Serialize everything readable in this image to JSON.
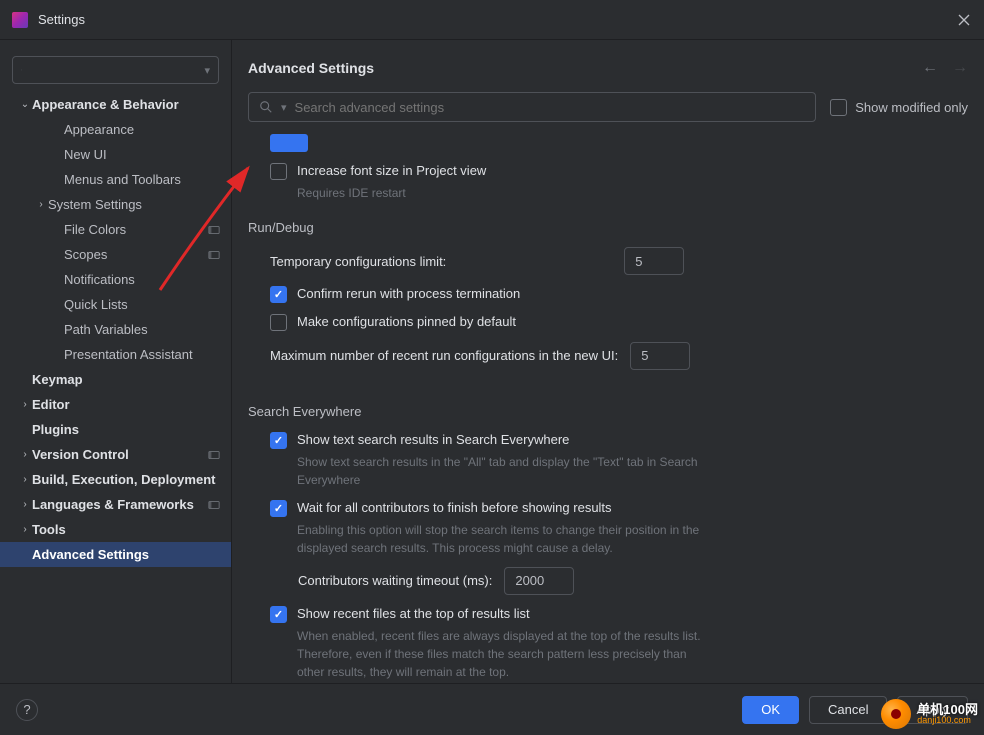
{
  "titlebar": {
    "title": "Settings"
  },
  "sidebar": {
    "search_placeholder": "",
    "items": [
      {
        "label": "Appearance & Behavior",
        "bold": true,
        "arrow": "down",
        "lvl": 0,
        "proj": false
      },
      {
        "label": "Appearance",
        "bold": false,
        "arrow": "",
        "lvl": 1,
        "proj": false
      },
      {
        "label": "New UI",
        "bold": false,
        "arrow": "",
        "lvl": 1,
        "proj": false
      },
      {
        "label": "Menus and Toolbars",
        "bold": false,
        "arrow": "",
        "lvl": 1,
        "proj": false
      },
      {
        "label": "System Settings",
        "bold": false,
        "arrow": "right",
        "lvl": "1b",
        "proj": false
      },
      {
        "label": "File Colors",
        "bold": false,
        "arrow": "",
        "lvl": 1,
        "proj": true
      },
      {
        "label": "Scopes",
        "bold": false,
        "arrow": "",
        "lvl": 1,
        "proj": true
      },
      {
        "label": "Notifications",
        "bold": false,
        "arrow": "",
        "lvl": 1,
        "proj": false
      },
      {
        "label": "Quick Lists",
        "bold": false,
        "arrow": "",
        "lvl": 1,
        "proj": false
      },
      {
        "label": "Path Variables",
        "bold": false,
        "arrow": "",
        "lvl": 1,
        "proj": false
      },
      {
        "label": "Presentation Assistant",
        "bold": false,
        "arrow": "",
        "lvl": 1,
        "proj": false
      },
      {
        "label": "Keymap",
        "bold": true,
        "arrow": "",
        "lvl": 0,
        "proj": false
      },
      {
        "label": "Editor",
        "bold": true,
        "arrow": "right",
        "lvl": 0,
        "proj": false
      },
      {
        "label": "Plugins",
        "bold": true,
        "arrow": "",
        "lvl": 0,
        "proj": false
      },
      {
        "label": "Version Control",
        "bold": true,
        "arrow": "right",
        "lvl": 0,
        "proj": true
      },
      {
        "label": "Build, Execution, Deployment",
        "bold": true,
        "arrow": "right",
        "lvl": 0,
        "proj": false
      },
      {
        "label": "Languages & Frameworks",
        "bold": true,
        "arrow": "right",
        "lvl": 0,
        "proj": true
      },
      {
        "label": "Tools",
        "bold": true,
        "arrow": "right",
        "lvl": 0,
        "proj": false
      },
      {
        "label": "Advanced Settings",
        "bold": true,
        "arrow": "",
        "lvl": 0,
        "proj": false,
        "active": true
      }
    ]
  },
  "main": {
    "title": "Advanced Settings",
    "search_placeholder": "Search advanced settings",
    "show_modified_label": "Show modified only",
    "sections": {
      "presentation": {
        "increase_font_label": "Increase font size in Project view",
        "increase_font_hint": "Requires IDE restart"
      },
      "run_debug": {
        "title": "Run/Debug",
        "temp_limit_label": "Temporary configurations limit:",
        "temp_limit_value": "5",
        "confirm_rerun_label": "Confirm rerun with process termination",
        "pinned_label": "Make configurations pinned by default",
        "max_recent_label": "Maximum number of recent run configurations in the new UI:",
        "max_recent_value": "5"
      },
      "search_everywhere": {
        "title": "Search Everywhere",
        "show_text_label": "Show text search results in Search Everywhere",
        "show_text_hint": "Show text search results in the \"All\" tab and display the \"Text\" tab in Search Everywhere",
        "wait_label": "Wait for all contributors to finish before showing results",
        "wait_hint": "Enabling this option will stop the search items to change their position in the displayed search results. This process might cause a delay.",
        "timeout_label": "Contributors waiting timeout (ms):",
        "timeout_value": "2000",
        "recent_label": "Show recent files at the top of results list",
        "recent_hint": "When enabled, recent files are always displayed at the top of the results list. Therefore, even if these files match the search pattern less precisely than other results, they will remain at the top."
      }
    }
  },
  "footer": {
    "ok": "OK",
    "cancel": "Cancel",
    "apply": "Apply"
  },
  "watermark": {
    "top": "单机100网",
    "bottom": "danji100.com"
  }
}
